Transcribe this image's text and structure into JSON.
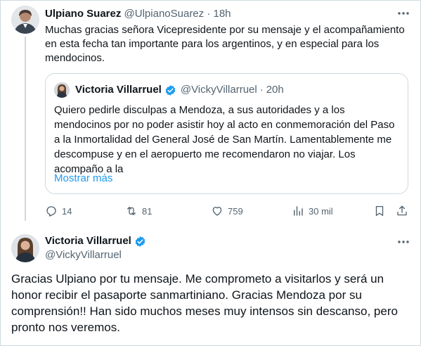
{
  "tweet": {
    "author_name": "Ulpiano Suarez",
    "author_handle": "@UlpianoSuarez",
    "separator": "·",
    "time": "18h",
    "text": "Muchas gracias señora Vicepresidente por su mensaje y el acompañamiento en esta fecha tan importante para los argentinos, y en especial para los mendocinos.",
    "quoted": {
      "author_name": "Victoria Villarruel",
      "author_handle": "@VickyVillarruel",
      "separator": "·",
      "time": "20h",
      "text": "Quiero pedirle disculpas a Mendoza, a sus autoridades y a los mendocinos por no poder asistir hoy al acto en conmemoración del Paso a la Inmortalidad del General José de San Martín. Lamentablemente me descompuse y en el aeropuerto me recomendaron no viajar. Los acompaño a la",
      "show_more": "Mostrar más"
    },
    "actions": {
      "replies": "14",
      "retweets": "81",
      "likes": "759",
      "views": "30 mil"
    }
  },
  "reply": {
    "author_name": "Victoria Villarruel",
    "author_handle": "@VickyVillarruel",
    "text": "Gracias Ulpiano por tu mensaje. Me comprometo a visitarlos y será un honor recibir el pasaporte sanmartiniano. Gracias Mendoza por su comprensión!! Han sido muchos meses muy intensos sin descanso, pero pronto nos veremos."
  },
  "colors": {
    "verified": "#1d9bf0",
    "link": "#1d9bf0",
    "muted": "#536471",
    "border": "#cfd9de"
  },
  "icons": [
    "more-icon",
    "verified-badge-icon",
    "reply-icon",
    "retweet-icon",
    "like-icon",
    "views-icon",
    "bookmark-icon",
    "share-icon"
  ]
}
